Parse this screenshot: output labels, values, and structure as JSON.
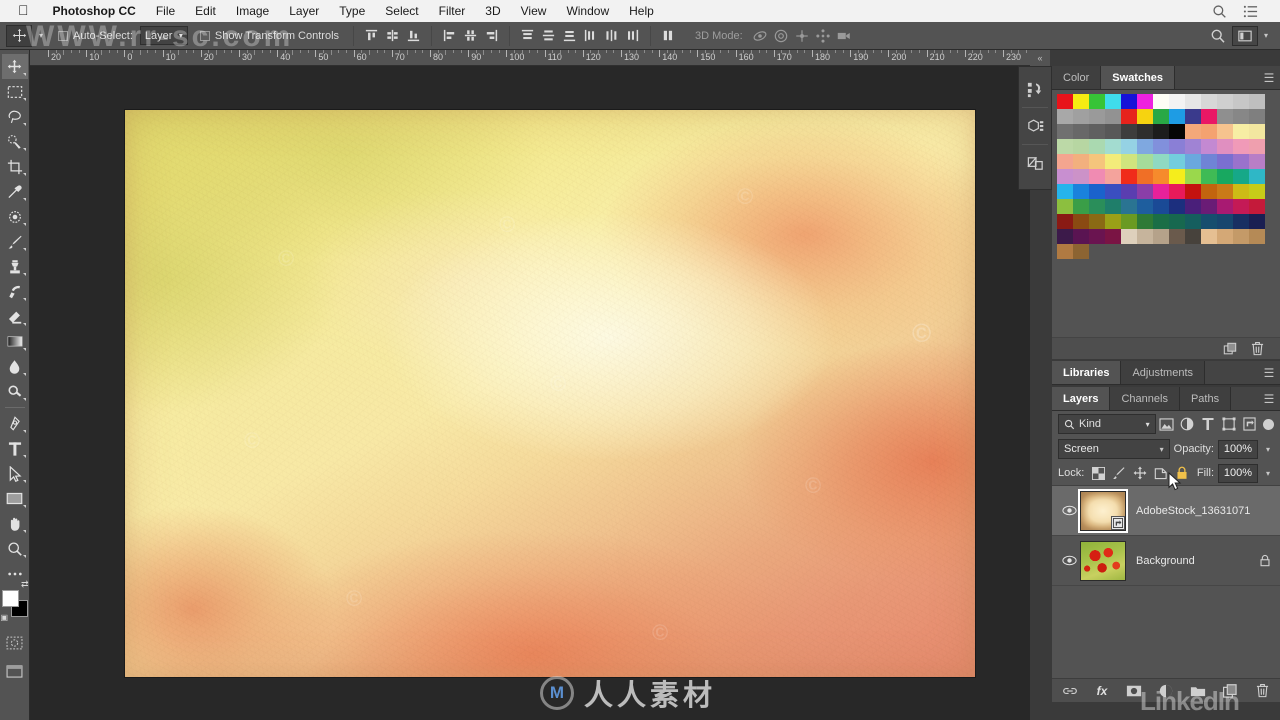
{
  "app": {
    "name": "Photoshop CC",
    "menus": [
      "File",
      "Edit",
      "Image",
      "Layer",
      "Type",
      "Select",
      "Filter",
      "3D",
      "View",
      "Window",
      "Help"
    ],
    "right_icons": [
      "search-icon",
      "list-icon"
    ]
  },
  "options_bar": {
    "tool": "move-tool",
    "auto_select_label": "Auto-Select:",
    "auto_select_checked": false,
    "auto_select_value": "Layer",
    "show_transform_label": "Show Transform Controls",
    "show_transform_checked": false,
    "align_group_1": [
      "align-top-edges",
      "align-vertical-centers",
      "align-bottom-edges"
    ],
    "align_group_2": [
      "align-left-edges",
      "align-horizontal-centers",
      "align-right-edges"
    ],
    "distribute_group_1": [
      "distribute-top-edges",
      "distribute-vertical-centers",
      "distribute-bottom-edges"
    ],
    "distribute_group_2": [
      "distribute-left-edges",
      "distribute-horizontal-centers",
      "distribute-right-edges"
    ],
    "more_label": "align-distribute-more",
    "mode_3d_label": "3D Mode:",
    "mode_3d_icons": [
      "rotate-3d-icon",
      "roll-3d-icon",
      "drag-3d-icon",
      "slide-3d-icon",
      "scale-3d-icon"
    ],
    "search_icon": "search-icon",
    "workspace_icon": "workspace-switcher-icon"
  },
  "ruler": {
    "corner_icon": "ruler-origin",
    "labels": [
      "20",
      "10",
      "0",
      "10",
      "20",
      "30",
      "40",
      "50",
      "60",
      "70",
      "80",
      "90",
      "100",
      "110",
      "120",
      "130",
      "140",
      "150",
      "160",
      "170",
      "180",
      "190",
      "200",
      "210",
      "220",
      "230"
    ],
    "collapse_glyph": "«"
  },
  "toolbar": {
    "tools": [
      {
        "name": "move-tool",
        "active": true
      },
      {
        "name": "rectangular-marquee-tool",
        "active": false
      },
      {
        "name": "lasso-tool",
        "active": false
      },
      {
        "name": "quick-selection-tool",
        "active": false
      },
      {
        "name": "crop-tool",
        "active": false
      },
      {
        "name": "eyedropper-tool",
        "active": false
      },
      {
        "name": "spot-healing-brush-tool",
        "active": false
      },
      {
        "name": "brush-tool",
        "active": false
      },
      {
        "name": "clone-stamp-tool",
        "active": false
      },
      {
        "name": "history-brush-tool",
        "active": false
      },
      {
        "name": "eraser-tool",
        "active": false
      },
      {
        "name": "gradient-tool",
        "active": false
      },
      {
        "name": "blur-tool",
        "active": false
      },
      {
        "name": "dodge-tool",
        "active": false
      },
      {
        "name": "pen-tool",
        "active": false
      },
      {
        "name": "type-tool",
        "active": false
      },
      {
        "name": "path-selection-tool",
        "active": false
      },
      {
        "name": "rectangle-tool",
        "active": false
      },
      {
        "name": "hand-tool",
        "active": false
      },
      {
        "name": "zoom-tool",
        "active": false
      },
      {
        "name": "edit-toolbar-more",
        "active": false
      }
    ],
    "foreground_color": "#ffffff",
    "background_color": "#000000",
    "quick_mask_icon": "quick-mask-mode",
    "screen_mode_icon": "screen-mode"
  },
  "side_icons": [
    "history-panel-icon",
    "3d-panel-icon",
    "properties-panel-icon"
  ],
  "swatches_panel": {
    "tabs": [
      {
        "label": "Color",
        "active": false
      },
      {
        "label": "Swatches",
        "active": true
      }
    ],
    "menu_icon": "panel-menu-icon",
    "rows": [
      [
        "#e8131a",
        "#f6ec12",
        "#37c437",
        "#3fdcec",
        "#1512d8",
        "#ee22e0",
        "#fdfdf5",
        "#f3f3f3",
        "#e6e6e6",
        "#d7d7d7",
        "#cfcfcf",
        "#c7c7c7",
        "#bfbfbf"
      ],
      [
        "#a8a8a8",
        "#a0a0a0",
        "#9a9a9a",
        "#929292",
        "#e6231c",
        "#f6d310",
        "#29a845",
        "#1e9ce4",
        "#3a3a8c",
        "#ea1765",
        "#8f8f8f",
        "#878787",
        "#7f7f7f"
      ],
      [
        "#707070",
        "#686868",
        "#606060",
        "#585858",
        "#3d3d3d",
        "#2e2e2e",
        "#1c1c1c",
        "#050505",
        "#f4a87a",
        "#f4a270",
        "#f6c38e",
        "#f7eea4",
        "#f3e7a0"
      ],
      [
        "#bcd9a7",
        "#b7d6a2",
        "#aad9b0",
        "#a3dcd0",
        "#95d2e4",
        "#7fa8e0",
        "#8190dc",
        "#8a7fd6",
        "#a083d4",
        "#c389d2",
        "#e08fc0",
        "#f09ab8",
        "#ef9fae"
      ],
      [
        "#f4a58f",
        "#f2b07e",
        "#f5c57c",
        "#f3ec7a",
        "#d0e47e",
        "#a5dc9a",
        "#8fd9c2",
        "#73cddd",
        "#6aa8de",
        "#6f84d6",
        "#7a6fd0",
        "#9a72cc",
        "#b87ec6"
      ],
      [
        "#c88fd0",
        "#cc92c8",
        "#f08bb2",
        "#f4a39c",
        "#f02c1a",
        "#f06f26",
        "#f68b2c",
        "#f5ed1c",
        "#9ad84c",
        "#3fbb55",
        "#18a860",
        "#16a888",
        "#2fb7c6"
      ],
      [
        "#26b4ec",
        "#1a82dc",
        "#1a62cc",
        "#3a4ec0",
        "#5a3eb0",
        "#8a3ea8",
        "#e8219a",
        "#e81a5a",
        "#c4120f",
        "#c2640f",
        "#ca7a18",
        "#cdbb16",
        "#c7cc18"
      ],
      [
        "#8cbf3f",
        "#3a9e47",
        "#2a8e5a",
        "#1f7e6a",
        "#2a7492",
        "#1e5e9e",
        "#1a4a96",
        "#1c2f7e",
        "#4a1f7a",
        "#6a1c76",
        "#a81a72",
        "#c41a56",
        "#c41a3a"
      ],
      [
        "#8a1a14",
        "#8a4a12",
        "#8a6a14",
        "#9aa017",
        "#6a9a22",
        "#2e7a36",
        "#1a6e46",
        "#17684f",
        "#155e5e",
        "#164e6e",
        "#17466e",
        "#182f62",
        "#1a1f52"
      ],
      [
        "#3c1a4a",
        "#5a1452",
        "#6a1450",
        "#7a1444",
        "#ded0bc",
        "#c6b49c",
        "#b5a28a",
        "#6a5a4c",
        "#47423c",
        "#e5bf92",
        "#d4a876",
        "#c49a68",
        "#b58a56"
      ],
      [
        "#b07a42",
        "#8c6432"
      ]
    ],
    "footer_icons": [
      "new-swatch-icon",
      "delete-swatch-icon"
    ]
  },
  "libraries_panel": {
    "tabs": [
      {
        "label": "Libraries",
        "active": true
      },
      {
        "label": "Adjustments",
        "active": false
      }
    ],
    "menu_icon": "panel-menu-icon"
  },
  "layers_panel": {
    "tabs": [
      {
        "label": "Layers",
        "active": true
      },
      {
        "label": "Channels",
        "active": false
      },
      {
        "label": "Paths",
        "active": false
      }
    ],
    "menu_icon": "panel-menu-icon",
    "filter": {
      "kind_label": "Kind",
      "search_icon": "search-icon",
      "caret": "⌄",
      "icons": [
        "filter-pixel-icon",
        "filter-adjustment-icon",
        "filter-type-icon",
        "filter-shape-icon",
        "filter-smart-object-icon"
      ],
      "toggle_icon": "filter-enable-toggle"
    },
    "blend": {
      "mode": "Screen",
      "caret": "⌄",
      "opacity_label": "Opacity:",
      "opacity_value": "100%"
    },
    "lock": {
      "label": "Lock:",
      "icons": [
        "lock-transparent-pixels-icon",
        "lock-image-pixels-icon",
        "lock-position-icon",
        "lock-artboard-nesting-icon",
        "lock-all-icon"
      ],
      "fill_label": "Fill:",
      "fill_value": "100%"
    },
    "layers": [
      {
        "name": "AdobeStock_13631071",
        "visible": true,
        "selected": true,
        "thumb": "paper-texture",
        "smart_object": true,
        "locked": false
      },
      {
        "name": "Background",
        "visible": true,
        "selected": false,
        "thumb": "poppy-field",
        "smart_object": false,
        "locked": true
      }
    ],
    "footer_icons": [
      "link-layers-icon",
      "layer-style-fx-icon",
      "add-layer-mask-icon",
      "new-adjustment-layer-icon",
      "new-group-icon",
      "new-layer-icon",
      "delete-layer-icon"
    ],
    "fx_label": "fx"
  },
  "watermarks": {
    "top_site": "WWW.rr-sc.com",
    "bottom_brand": "人人素材",
    "bottom_logo_letter": "M",
    "corner_brand": "LinkedIn"
  },
  "canvas": {
    "document_thumb": "watercolor-texture-overlay",
    "background_color": "#282828"
  }
}
